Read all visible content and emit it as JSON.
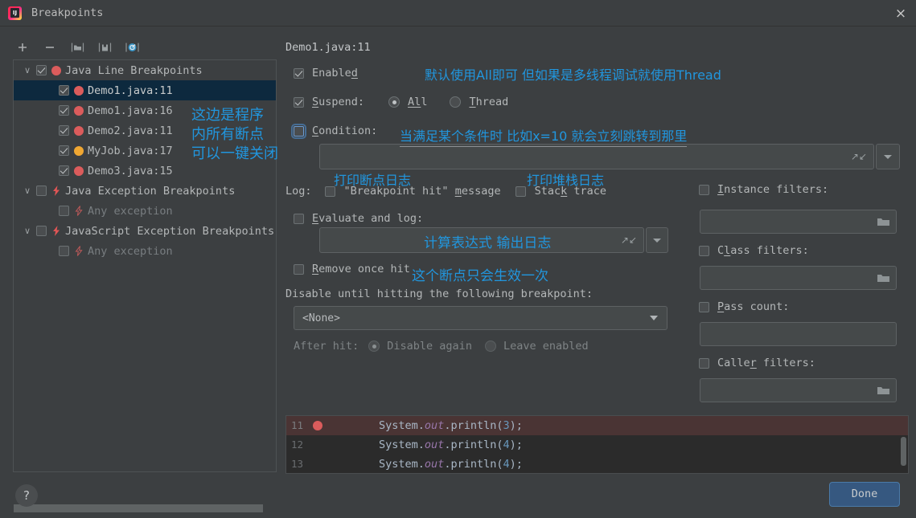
{
  "window": {
    "title": "Breakpoints",
    "logo_text": "IJ",
    "close_icon": "×"
  },
  "left_panel": {
    "toolbar": [
      {
        "name": "add-breakpoint-button",
        "icon": "plus-icon"
      },
      {
        "name": "remove-breakpoint-button",
        "icon": "minus-icon"
      },
      {
        "name": "new-group-button",
        "icon": "folder-icon"
      },
      {
        "name": "move-to-group-button",
        "icon": "move-to-group-icon"
      },
      {
        "name": "mute-breakpoints-button",
        "icon": "mute-breakpoints-icon"
      }
    ],
    "tree": [
      {
        "label": "Java Line Breakpoints",
        "twisty": "∨",
        "checked": true,
        "marker": "red-dot",
        "indent": 0,
        "selected": false,
        "dim": false
      },
      {
        "label": "Demo1.java:11",
        "twisty": "",
        "checked": true,
        "marker": "red-dot",
        "indent": 1,
        "selected": true,
        "dim": false
      },
      {
        "label": "Demo1.java:16",
        "twisty": "",
        "checked": true,
        "marker": "red-dot",
        "indent": 1,
        "selected": false,
        "dim": false
      },
      {
        "label": "Demo2.java:11",
        "twisty": "",
        "checked": true,
        "marker": "red-dot",
        "indent": 1,
        "selected": false,
        "dim": false
      },
      {
        "label": "MyJob.java:17",
        "twisty": "",
        "checked": true,
        "marker": "yellow-dot",
        "indent": 1,
        "selected": false,
        "dim": false
      },
      {
        "label": "Demo3.java:15",
        "twisty": "",
        "checked": true,
        "marker": "red-dot",
        "indent": 1,
        "selected": false,
        "dim": false
      },
      {
        "label": "Java Exception Breakpoints",
        "twisty": "∨",
        "checked": false,
        "marker": "bolt",
        "indent": 0,
        "selected": false,
        "dim": false
      },
      {
        "label": "Any exception",
        "twisty": "",
        "checked": false,
        "marker": "bolt-dim",
        "indent": 1,
        "selected": false,
        "dim": true
      },
      {
        "label": "JavaScript Exception Breakpoints",
        "twisty": "∨",
        "checked": false,
        "marker": "bolt",
        "indent": 0,
        "selected": false,
        "dim": false
      },
      {
        "label": "Any exception",
        "twisty": "",
        "checked": false,
        "marker": "bolt-dim",
        "indent": 1,
        "selected": false,
        "dim": true
      }
    ]
  },
  "detail": {
    "breakpoint_title": "Demo1.java:11",
    "enabled_label": "Enabled",
    "enabled_checked": true,
    "suspend_label": "Suspend:",
    "suspend_checked": true,
    "suspend_all_label": "All",
    "suspend_thread_label": "Thread",
    "suspend_value": "All",
    "condition_label": "Condition:",
    "condition_checked": false,
    "condition_value": "",
    "log_label": "Log:",
    "log_message_label": "\"Breakpoint hit\" message",
    "log_message_checked": false,
    "log_stack_label": "Stack trace",
    "log_stack_checked": false,
    "evaluate_label": "Evaluate and log:",
    "evaluate_checked": false,
    "evaluate_value": "",
    "remove_once_hit_label": "Remove once hit",
    "remove_once_hit_checked": false,
    "disable_until_label": "Disable until hitting the following breakpoint:",
    "disable_until_value": "<None>",
    "after_hit_label": "After hit:",
    "after_hit_disable_label": "Disable again",
    "after_hit_leave_label": "Leave enabled",
    "after_hit_value": "Disable again"
  },
  "filters": {
    "instance_label": "Instance filters:",
    "instance_checked": false,
    "instance_value": "",
    "class_label": "Class filters:",
    "class_checked": false,
    "class_value": "",
    "pass_count_label": "Pass count:",
    "pass_count_checked": false,
    "pass_count_value": "",
    "caller_label": "Caller filters:",
    "caller_checked": false,
    "caller_value": ""
  },
  "code_preview": {
    "lines": [
      {
        "number": "11",
        "breakpoint": true,
        "highlight": true,
        "prefix": "        System.",
        "italic": "out",
        "mid": ".println(",
        "arg": "3",
        "suffix": ");"
      },
      {
        "number": "12",
        "breakpoint": false,
        "highlight": false,
        "prefix": "        System.",
        "italic": "out",
        "mid": ".println(",
        "arg": "4",
        "suffix": ");"
      },
      {
        "number": "13",
        "breakpoint": false,
        "highlight": false,
        "prefix": "        System.",
        "italic": "out",
        "mid": ".println(",
        "arg": "4",
        "suffix": ");"
      }
    ]
  },
  "footer": {
    "help_label": "?",
    "done_label": "Done"
  },
  "annotations": {
    "tree_note_line1": "这边是程序",
    "tree_note_line2": "内所有断点",
    "tree_note_line3": "可以一键关闭",
    "suspend_note": "默认使用All即可  但如果是多线程调试就使用Thread",
    "condition_note": "当满足某个条件时 比如x=10 就会立刻跳转到那里",
    "log_message_note": "打印断点日志",
    "log_stack_note": "打印堆栈日志",
    "evaluate_note": "计算表达式 输出日志",
    "remove_once_note": "这个断点只会生效一次",
    "color": "#2196de"
  }
}
